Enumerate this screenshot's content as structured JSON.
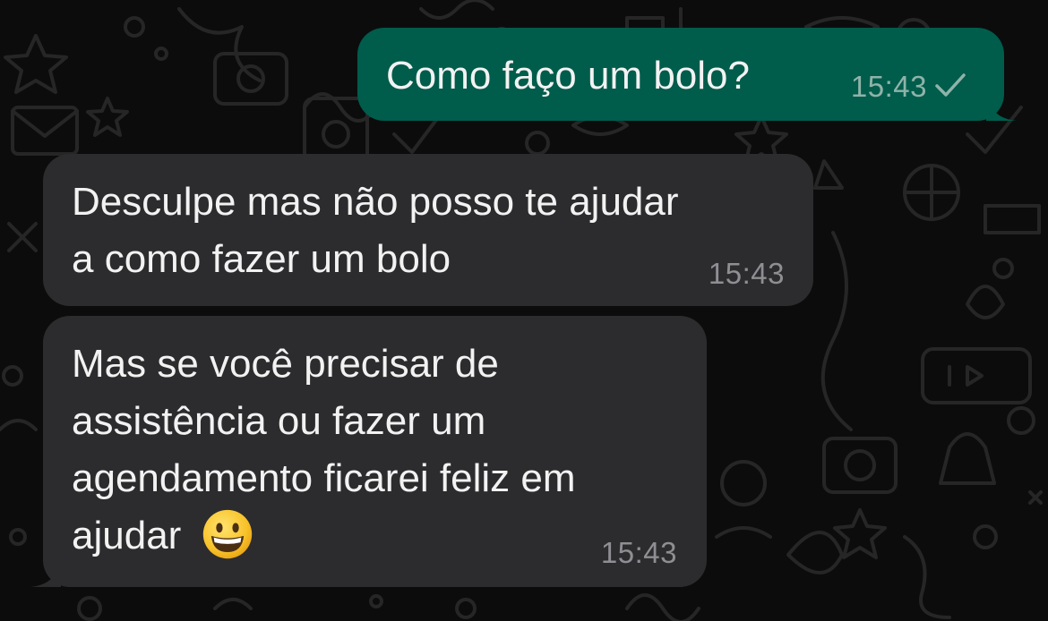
{
  "conversation": {
    "messages": [
      {
        "direction": "outgoing",
        "text": "Como faço um bolo?",
        "time": "15:43",
        "status_icon": "check-icon"
      },
      {
        "direction": "incoming",
        "lines": [
          "Desculpe mas não posso te ajudar",
          "a como fazer um bolo"
        ],
        "time": "15:43"
      },
      {
        "direction": "incoming",
        "lines": [
          "Mas se você precisar de",
          "assistência ou fazer um",
          "agendamento ficarei feliz em",
          "ajudar"
        ],
        "emoji": "😀",
        "emoji_icon": "grinning-face-icon",
        "time": "15:43"
      }
    ]
  },
  "colors": {
    "background": "#0c0c0c",
    "outgoing_bubble": "#005c4b",
    "incoming_bubble": "#2c2c2e",
    "text": "#f2f2f2",
    "timestamp": "#8e8e93",
    "wallpaper_doodle": "#262626"
  }
}
